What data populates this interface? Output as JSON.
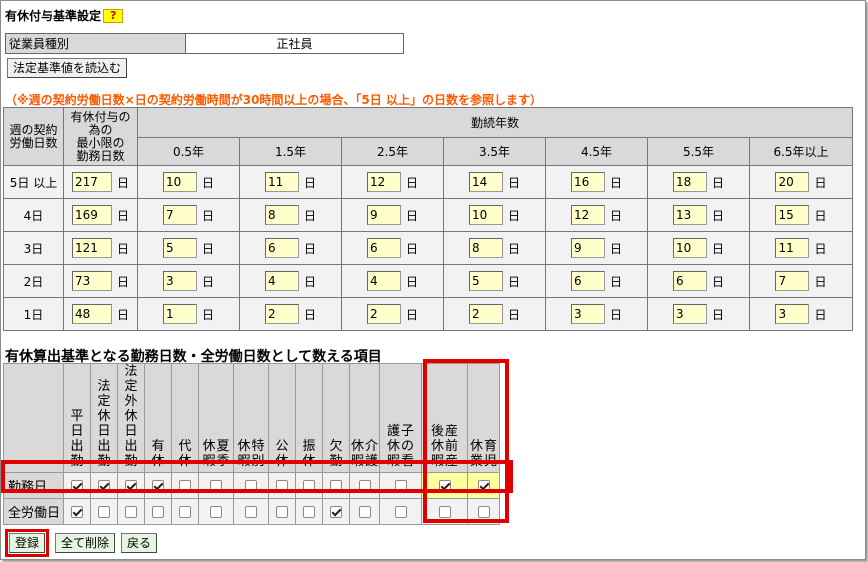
{
  "title": "有休付与基準設定",
  "help_label": "?",
  "employee": {
    "label": "従業員種別",
    "value": "正社員"
  },
  "load_button": "法定基準値を読込む",
  "note": "（※週の契約労働日数×日の契約労働時間が30時間以上の場合、「5日 以上」の日数を参照します）",
  "grant_table": {
    "col_days_header": [
      "週の契約",
      "労働日数"
    ],
    "col_min_header": [
      "有休付与の",
      "為の",
      "最小限の",
      "勤務日数"
    ],
    "years_header": "勤続年数",
    "years": [
      "0.5年",
      "1.5年",
      "2.5年",
      "3.5年",
      "4.5年",
      "5.5年",
      "6.5年以上"
    ],
    "unit": "日",
    "rows": [
      {
        "label": "5日 以上",
        "min": "217",
        "values": [
          "10",
          "11",
          "12",
          "14",
          "16",
          "18",
          "20"
        ]
      },
      {
        "label": "4日",
        "min": "169",
        "values": [
          "7",
          "8",
          "9",
          "10",
          "12",
          "13",
          "15"
        ]
      },
      {
        "label": "3日",
        "min": "121",
        "values": [
          "5",
          "6",
          "6",
          "8",
          "9",
          "10",
          "11"
        ]
      },
      {
        "label": "2日",
        "min": "73",
        "values": [
          "3",
          "4",
          "4",
          "5",
          "6",
          "6",
          "7"
        ]
      },
      {
        "label": "1日",
        "min": "48",
        "values": [
          "1",
          "2",
          "2",
          "2",
          "3",
          "3",
          "3"
        ]
      }
    ]
  },
  "items_title": "有休算出基準となる勤務日数・全労働日数として数える項目",
  "items": {
    "columns": [
      [
        "平日出勤"
      ],
      [
        "法定休日出勤"
      ],
      [
        "法定外休日出勤"
      ],
      [
        "有休"
      ],
      [
        "代休"
      ],
      [
        "夏季",
        "休暇"
      ],
      [
        "特別",
        "休暇"
      ],
      [
        "公休"
      ],
      [
        "振休"
      ],
      [
        "欠勤"
      ],
      [
        "介護",
        "休暇"
      ],
      [
        "子の看",
        "護休暇"
      ],
      [
        "産前産",
        "後休暇"
      ],
      [
        "育児",
        "休業"
      ]
    ],
    "rows": [
      {
        "label": "勤務日",
        "checks": [
          true,
          true,
          true,
          true,
          false,
          false,
          false,
          false,
          false,
          false,
          false,
          false,
          true,
          true
        ]
      },
      {
        "label": "全労働日",
        "checks": [
          true,
          false,
          false,
          false,
          false,
          false,
          false,
          false,
          false,
          true,
          false,
          false,
          false,
          false
        ]
      }
    ]
  },
  "buttons": {
    "save": "登録",
    "delete_all": "全て削除",
    "back": "戻る"
  }
}
